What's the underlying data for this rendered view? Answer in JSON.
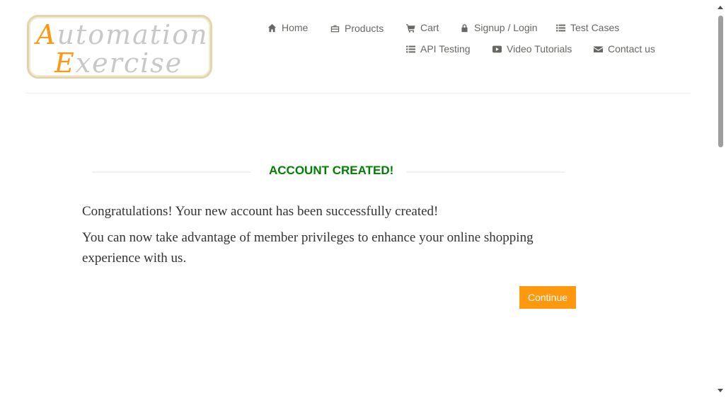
{
  "logo": {
    "line1_cap": "A",
    "line1_rest": "utomation",
    "line2_cap": "E",
    "line2_rest": "xercise"
  },
  "nav": {
    "home": "Home",
    "products": "Products",
    "cart": "Cart",
    "signup_login": "Signup / Login",
    "test_cases": "Test Cases",
    "api_testing": "API Testing",
    "video_tutorials": "Video Tutorials",
    "contact_us": "Contact us"
  },
  "content": {
    "title": "ACCOUNT CREATED!",
    "paragraph_1": "Congratulations! Your new account has been successfully created!",
    "paragraph_2": "You can now take advantage of member privileges to enhance your online shopping experience with us.",
    "continue_label": "Continue"
  },
  "colors": {
    "accent": "#fe980f",
    "success": "#008000",
    "nav_text": "#696763"
  }
}
